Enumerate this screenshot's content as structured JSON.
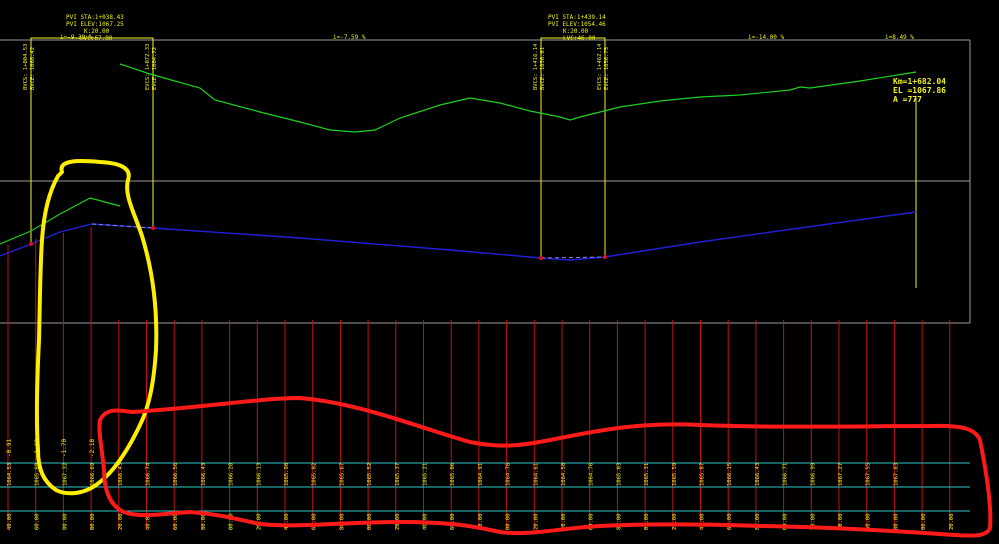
{
  "pvi_labels": [
    {
      "lines": [
        "PVI  STA:1+038.43",
        "PVI  ELEV:1067.25",
        "K:20.00",
        "LVC:67.80"
      ]
    },
    {
      "lines": [
        "PVI  STA:1+439.14",
        "PVI  ELEV:1054.46",
        "K:20.00",
        "LVC:46.00"
      ]
    }
  ],
  "grade_labels": [
    "i=-9.38 %",
    "i=-7.59 %",
    "i=-14.00 %",
    "i=8.49 %"
  ],
  "pvc_pvt_labels": [
    [
      "BVCS: 1+004.53",
      "BVCE: 1068.42"
    ],
    [
      "EVCS: 1+072.33",
      "EVCE: 1064.72"
    ],
    [
      "BVCS: 1+416.14",
      "BVCE: 1056.61"
    ],
    [
      "EVCS: 1+462.14",
      "EVCE: 1056.75"
    ]
  ],
  "end_station": {
    "km": "Km=1+682.04",
    "el": "EL =1067.86",
    "a": "A =777"
  },
  "offset_values": [
    "-0.91",
    "-1.18",
    "-1.70",
    "-2.18"
  ],
  "elevations": [
    "1064.53",
    "1065.69",
    "1067.32",
    "1066.69",
    "1066.43",
    "1066.74",
    "1066.56",
    "1066.43",
    "1066.28",
    "1066.13",
    "1065.98",
    "1065.82",
    "1065.67",
    "1065.52",
    "1065.37",
    "1065.21",
    "1065.06",
    "1064.91",
    "1064.76",
    "1064.61",
    "1064.58",
    "1064.76",
    "1065.03",
    "1065.31",
    "1065.59",
    "1065.87",
    "1066.15",
    "1066.43",
    "1066.71",
    "1066.99",
    "1067.27",
    "1067.55",
    "1067.83"
  ],
  "stations": [
    "40.00",
    "60.00",
    "80.00",
    "00.00",
    "20.00",
    "40.00",
    "60.00",
    "80.00",
    "00.00",
    "20.00",
    "40.00",
    "60.00",
    "80.00",
    "00.00",
    "20.00",
    "40.00",
    "60.00",
    "80.00",
    "00.00",
    "20.00",
    "40.00",
    "60.00",
    "80.00",
    "00.00",
    "20.00",
    "40.00",
    "60.00",
    "80.00",
    "00.00",
    "20.00",
    "40.00",
    "60.00",
    "80.00",
    "00.00",
    "20.00"
  ],
  "colors": {
    "background": "#000000",
    "existing_ground": "#1fd11f",
    "design_grade": "#1f1fd0",
    "annotation": "#f2f21a",
    "station_ticks": "#c41010",
    "table_lines": "#2ec4c4",
    "frame": "#9a9a9a",
    "highlight_yellow": "#ffee00",
    "highlight_red": "#ff1a1a"
  }
}
